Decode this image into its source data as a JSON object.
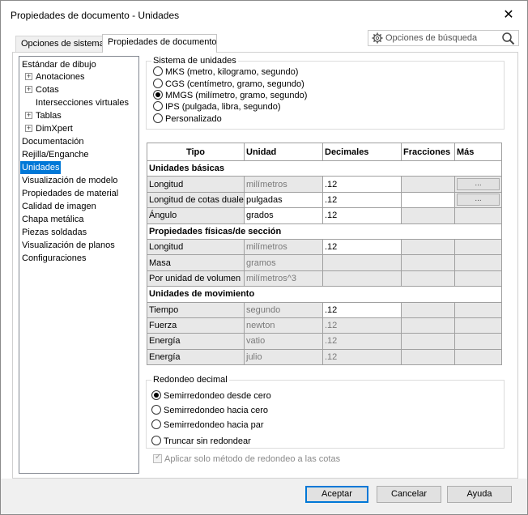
{
  "window": {
    "title": "Propiedades de documento - Unidades",
    "close_glyph": "✕"
  },
  "tabs": [
    {
      "label": "Opciones de sistema",
      "active": false
    },
    {
      "label": "Propiedades de documento",
      "active": true
    }
  ],
  "search": {
    "label": "Opciones de búsqueda",
    "icons": [
      "gear-icon",
      "search-icon"
    ]
  },
  "tree": {
    "items": [
      {
        "label": "Estándar de dibujo"
      },
      {
        "label": "Anotaciones",
        "expander": "+"
      },
      {
        "label": "Cotas",
        "expander": "+"
      },
      {
        "label": "Intersecciones virtuales"
      },
      {
        "label": "Tablas",
        "expander": "+"
      },
      {
        "label": "DimXpert",
        "expander": "+"
      },
      {
        "label": "Documentación"
      },
      {
        "label": "Rejilla/Enganche"
      },
      {
        "label": "Unidades",
        "selected": true
      },
      {
        "label": "Visualización de modelo"
      },
      {
        "label": "Propiedades de material"
      },
      {
        "label": "Calidad de imagen"
      },
      {
        "label": "Chapa metálica"
      },
      {
        "label": "Piezas soldadas"
      },
      {
        "label": "Visualización de planos"
      },
      {
        "label": "Configuraciones"
      }
    ]
  },
  "unit_system": {
    "legend": "Sistema de unidades",
    "options": [
      {
        "label": "MKS (metro, kilogramo, segundo)",
        "selected": false
      },
      {
        "label": "CGS (centímetro, gramo, segundo)",
        "selected": false
      },
      {
        "label": "MMGS (milímetro, gramo, segundo)",
        "selected": true
      },
      {
        "label": "IPS (pulgada, libra, segundo)",
        "selected": false
      },
      {
        "label": "Personalizado",
        "selected": false
      }
    ]
  },
  "table": {
    "headers": [
      "Tipo",
      "Unidad",
      "Decimales",
      "Fracciones",
      "Más"
    ],
    "sections": [
      {
        "title": "Unidades básicas",
        "rows": [
          {
            "tipo": "Longitud",
            "unidad": "milímetros",
            "decimales": ".12",
            "editable": true,
            "more": "..."
          },
          {
            "tipo": "Longitud de cotas duales",
            "unidad": "pulgadas",
            "decimales": ".12",
            "editable": true,
            "unit_white": true,
            "more": "..."
          },
          {
            "tipo": "Ángulo",
            "unidad": "grados",
            "decimales": ".12",
            "editable": true,
            "unit_white": true
          }
        ]
      },
      {
        "title": "Propiedades físicas/de sección",
        "rows": [
          {
            "tipo": "Longitud",
            "unidad": "milímetros",
            "decimales": ".12",
            "editable": true
          },
          {
            "tipo": "Masa",
            "unidad": "gramos",
            "decimales": "",
            "editable": false
          },
          {
            "tipo": "Por unidad de volumen",
            "unidad": "milímetros^3",
            "decimales": "",
            "editable": false
          }
        ]
      },
      {
        "title": "Unidades de movimiento",
        "rows": [
          {
            "tipo": "Tiempo",
            "unidad": "segundo",
            "decimales": ".12",
            "editable": true
          },
          {
            "tipo": "Fuerza",
            "unidad": "newton",
            "decimales": ".12",
            "editable": false
          },
          {
            "tipo": "Energía",
            "unidad": "vatio",
            "decimales": ".12",
            "editable": false
          },
          {
            "tipo": "Energía",
            "unidad": "julio",
            "decimales": ".12",
            "editable": false
          }
        ]
      }
    ]
  },
  "rounding": {
    "legend": "Redondeo decimal",
    "options": [
      {
        "label": "Semirredondeo desde cero",
        "selected": true
      },
      {
        "label": "Semirredondeo hacia cero",
        "selected": false
      },
      {
        "label": "Semirredondeo hacia par",
        "selected": false
      },
      {
        "label": "Truncar sin redondear",
        "selected": false
      }
    ]
  },
  "apply_only_dims": {
    "label": "Aplicar solo método de redondeo a las cotas",
    "checked": true,
    "enabled": false
  },
  "buttons": {
    "ok": "Aceptar",
    "cancel": "Cancelar",
    "help": "Ayuda"
  }
}
